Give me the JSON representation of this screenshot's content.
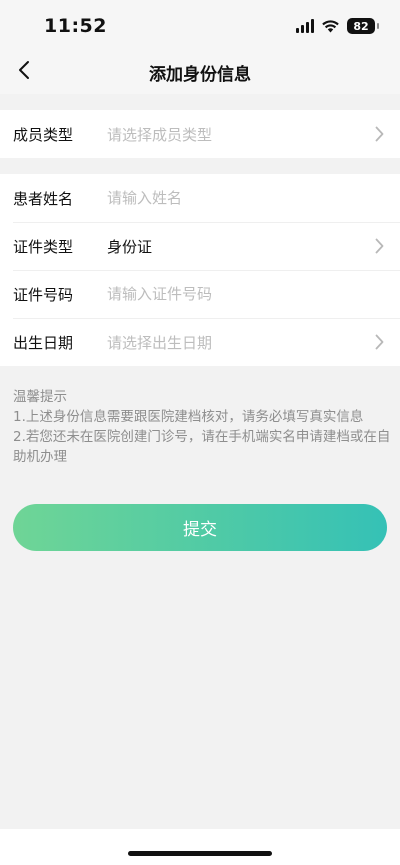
{
  "status_bar": {
    "time": "11:52",
    "battery": "82",
    "icons": [
      "signal-icon",
      "wifi-icon",
      "battery-icon"
    ]
  },
  "nav": {
    "title": "添加身份信息",
    "back_icon": "back-arrow-icon"
  },
  "member_section": {
    "label": "成员类型",
    "placeholder": "请选择成员类型"
  },
  "form": {
    "patient_name": {
      "label": "患者姓名",
      "placeholder": "请输入姓名",
      "value": ""
    },
    "id_type": {
      "label": "证件类型",
      "value": "身份证"
    },
    "id_number": {
      "label": "证件号码",
      "placeholder": "请输入证件号码",
      "value": ""
    },
    "birth_date": {
      "label": "出生日期",
      "placeholder": "请选择出生日期"
    }
  },
  "tips": {
    "title": "温馨提示",
    "line1": "1.上述身份信息需要跟医院建档核对，请务必填写真实信息",
    "line2": "2.若您还未在医院创建门诊号，请在手机端实名申请建档或在自助机办理"
  },
  "submit": {
    "label": "提交"
  },
  "colors": {
    "background": "#f2f2f2",
    "placeholder": "#bdbdbd",
    "tip_text": "#8e8e8e",
    "button_gradient_start": "#6fd596",
    "button_gradient_end": "#35c1b6"
  }
}
